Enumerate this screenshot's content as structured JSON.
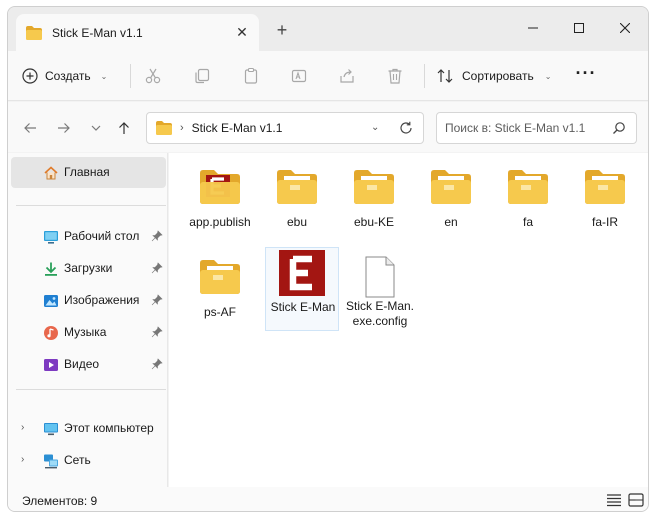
{
  "window": {
    "tab_title": "Stick E-Man v1.1",
    "tab_close": "✕",
    "new_tab": "+"
  },
  "toolbar": {
    "create_label": "Создать",
    "sort_label": "Сортировать",
    "more_label": "···",
    "dropdown_glyph": "⌄"
  },
  "address": {
    "crumb_separator": "›",
    "crumb": "Stick E-Man v1.1",
    "dropdown_glyph": "⌄",
    "search_placeholder": "Поиск в: Stick E-Man v1.1"
  },
  "sidebar": {
    "home": "Главная",
    "quick_access": [
      {
        "label": "Рабочий стол",
        "icon": "desktop-icon"
      },
      {
        "label": "Загрузки",
        "icon": "downloads-icon"
      },
      {
        "label": "Изображения",
        "icon": "pictures-icon"
      },
      {
        "label": "Музыка",
        "icon": "music-icon"
      },
      {
        "label": "Видео",
        "icon": "videos-icon"
      }
    ],
    "this_pc": "Этот компьютер",
    "network": "Сеть",
    "expand_glyph": "›"
  },
  "files": [
    {
      "name": "app.publish",
      "type": "folder-app"
    },
    {
      "name": "ebu",
      "type": "folder"
    },
    {
      "name": "ebu-KE",
      "type": "folder"
    },
    {
      "name": "en",
      "type": "folder"
    },
    {
      "name": "fa",
      "type": "folder"
    },
    {
      "name": "fa-IR",
      "type": "folder"
    },
    {
      "name": "ps-AF",
      "type": "folder"
    },
    {
      "name": "Stick E-Man",
      "type": "exe"
    },
    {
      "name": "Stick E-Man.exe.config",
      "type": "file"
    }
  ],
  "status": {
    "items_count": "Элементов: 9"
  },
  "colors": {
    "folder": "#f6c94d",
    "folder_dark": "#e3a82b",
    "app_red": "#a31612",
    "accent_blue": "#0067c0"
  }
}
